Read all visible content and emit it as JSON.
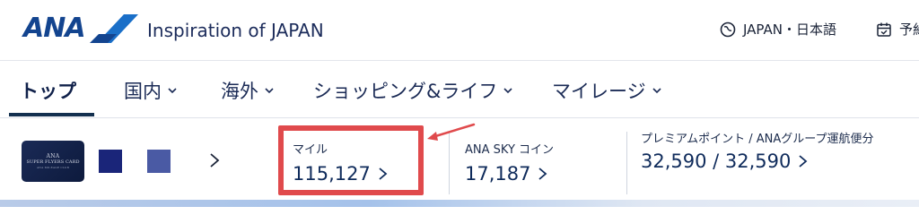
{
  "header": {
    "logo_text": "ANA",
    "tagline": "Inspiration of JAPAN",
    "language": "JAPAN・日本語",
    "schedule_label": "予約"
  },
  "nav": {
    "items": [
      {
        "label": "トップ",
        "has_dropdown": false,
        "active": true
      },
      {
        "label": "国内",
        "has_dropdown": true
      },
      {
        "label": "海外",
        "has_dropdown": true
      },
      {
        "label": "ショッピング&ライフ",
        "has_dropdown": true
      },
      {
        "label": "マイレージ",
        "has_dropdown": true
      }
    ]
  },
  "account": {
    "card": {
      "line1": "ANA",
      "line2": "SUPER FLYERS CARD",
      "line3": "ANA MILEAGE CLUB"
    },
    "miles": {
      "label": "マイル",
      "value": "115,127"
    },
    "sky_coin": {
      "label": "ANA SKY コイン",
      "value": "17,187"
    },
    "premium_points": {
      "label": "プレミアムポイント / ANAグループ運航便分",
      "value": "32,590 / 32,590"
    }
  },
  "colors": {
    "brand_navy": "#13448f",
    "highlight_red": "#e04a4c",
    "card_square_1": "#1a2579",
    "card_square_2": "#4a5aa4"
  }
}
